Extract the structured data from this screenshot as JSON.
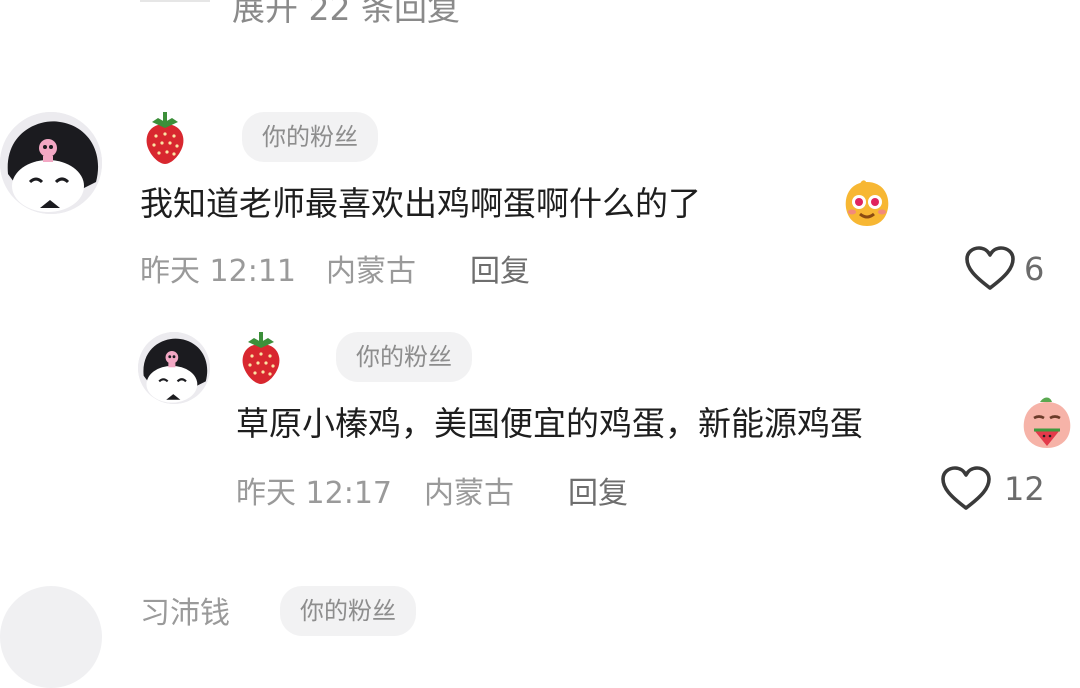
{
  "thread": {
    "expand_replies": "展开 22 条回复"
  },
  "comments": [
    {
      "badge": "你的粉丝",
      "text": "我知道老师最喜欢出鸡啊蛋啊什么的了",
      "time": "昨天 12:11",
      "location": "内蒙古",
      "reply_label": "回复",
      "likes": "6"
    }
  ],
  "replies": [
    {
      "badge": "你的粉丝",
      "text": "草原小榛鸡，美国便宜的鸡蛋，新能源鸡蛋",
      "time": "昨天 12:17",
      "location": "内蒙古",
      "reply_label": "回复",
      "likes": "12"
    }
  ],
  "next_comment": {
    "name": "习沛钱",
    "badge": "你的粉丝"
  },
  "icons": {
    "username": "strawberry-icon",
    "like": "heart-outline-icon",
    "comment_emoji": "smiling-face-emoji",
    "reply_emoji": "watermelon-face-emoji"
  },
  "colors": {
    "badge_bg": "#f2f2f3",
    "meta_text": "#9a9a9a",
    "strawberry": "#d8272f"
  }
}
